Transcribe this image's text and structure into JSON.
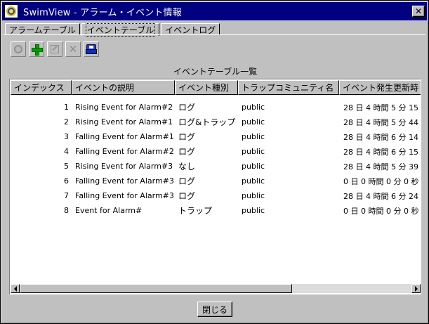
{
  "window": {
    "title": "SwimView - アラーム・イベント情報"
  },
  "tabs": [
    {
      "label": "アラームテーブル"
    },
    {
      "label": "イベントテーブル"
    },
    {
      "label": "イベントログ"
    }
  ],
  "toolbar": {
    "buttons": [
      {
        "icon": "gear-icon",
        "enabled": false
      },
      {
        "icon": "plus-icon",
        "enabled": true
      },
      {
        "icon": "edit-icon",
        "enabled": false
      },
      {
        "icon": "delete-icon",
        "enabled": false
      },
      {
        "icon": "print-icon",
        "enabled": true
      }
    ]
  },
  "list_title": "イベントテーブル一覧",
  "table": {
    "columns": [
      "インデックス",
      "イベントの説明",
      "イベント種別",
      "トラップコミュニティ名",
      "イベント発生更新時"
    ],
    "rows": [
      {
        "index": "1",
        "desc": "Rising Event for Alarm#2",
        "type": "ログ",
        "community": "public",
        "time": "28 日 4 時間 5 分 15"
      },
      {
        "index": "2",
        "desc": "Rising Event for Alarm#1",
        "type": "ログ&トラップ",
        "community": "public",
        "time": "28 日 4 時間 5 分 44"
      },
      {
        "index": "3",
        "desc": "Falling Event for Alarm#1",
        "type": "ログ",
        "community": "public",
        "time": "28 日 4 時間 6 分 14"
      },
      {
        "index": "4",
        "desc": "Falling Event for Alarm#2",
        "type": "ログ",
        "community": "public",
        "time": "28 日 4 時間 6 分 15"
      },
      {
        "index": "5",
        "desc": "Rising Event for Alarm#3",
        "type": "なし",
        "community": "public",
        "time": "28 日 4 時間 5 分 39"
      },
      {
        "index": "6",
        "desc": "Falling Event for Alarm#3",
        "type": "ログ",
        "community": "public",
        "time": "0 日 0 時間 0 分 0 秒"
      },
      {
        "index": "7",
        "desc": "Falling Event for Alarm#3",
        "type": "ログ",
        "community": "public",
        "time": "28 日 4 時間 6 分 24"
      },
      {
        "index": "8",
        "desc": "Event for Alarm#",
        "type": "トラップ",
        "community": "public",
        "time": "0 日 0 時間 0 分 0 秒"
      }
    ]
  },
  "close_label": "閉じる"
}
